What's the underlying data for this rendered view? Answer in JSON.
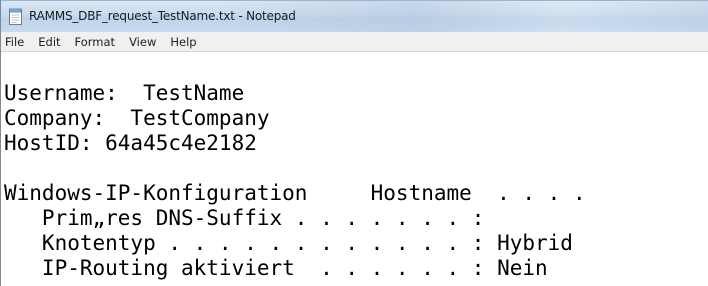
{
  "window": {
    "title": "RAMMS_DBF_request_TestName.txt - Notepad"
  },
  "icons": {
    "app": "notepad-icon"
  },
  "menu": [
    {
      "label": "File"
    },
    {
      "label": "Edit"
    },
    {
      "label": "Format"
    },
    {
      "label": "View"
    },
    {
      "label": "Help"
    }
  ],
  "document": {
    "lines": [
      "Username:  TestName",
      "Company:  TestCompany",
      "HostID: 64a45c4e2182",
      "",
      "Windows-IP-Konfiguration     Hostname  . . . .",
      "   Prim„res DNS-Suffix . . . . . . . :",
      "   Knotentyp . . . . . . . . . . . . : Hybrid",
      "   IP-Routing aktiviert  . . . . . . : Nein"
    ]
  }
}
